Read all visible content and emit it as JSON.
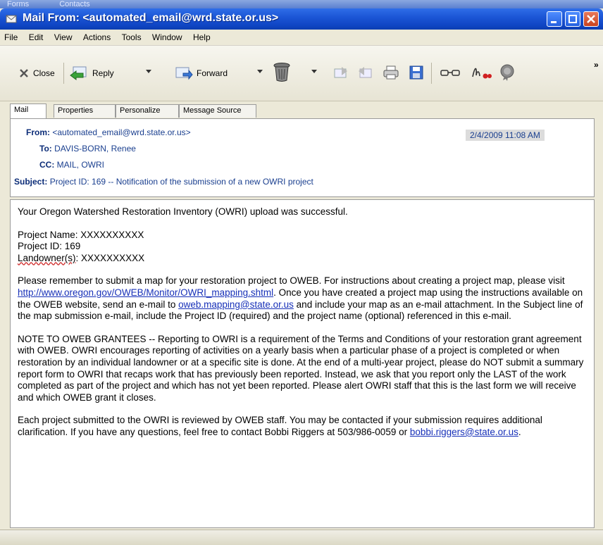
{
  "behind_window": {
    "items": [
      "Forms",
      "Contacts"
    ]
  },
  "window": {
    "title": "Mail From: <automated_email@wrd.state.or.us>"
  },
  "menu": [
    "File",
    "Edit",
    "View",
    "Actions",
    "Tools",
    "Window",
    "Help"
  ],
  "toolbar": {
    "close_label": "Close",
    "reply_label": "Reply",
    "forward_label": "Forward",
    "overflow": "»"
  },
  "tabs": [
    "Mail",
    "Properties",
    "Personalize",
    "Message Source"
  ],
  "header": {
    "from_label": "From:",
    "from_value": "<automated_email@wrd.state.or.us>",
    "date": "2/4/2009  11:08 AM",
    "to_label": "To:",
    "to_value": "DAVIS-BORN, Renee",
    "cc_label": "CC:",
    "cc_value": "MAIL, OWRI",
    "subject_label": "Subject:",
    "subject_value": "Project ID: 169 -- Notification of the submission of a new OWRI project"
  },
  "body": {
    "line1": "Your Oregon Watershed Restoration Inventory (OWRI) upload was successful.",
    "project_name": "Project Name: XXXXXXXXXX",
    "project_id": "Project ID: 169",
    "landowner_prefix": "Landowner(s)",
    "landowner_rest": ": XXXXXXXXXX",
    "p2_a": "Please remember to submit a map for your restoration project to OWEB.  For instructions about creating a project map, please visit ",
    "p2_link1": "http://www.oregon.gov/OWEB/Monitor/OWRI_mapping.shtml",
    "p2_b": ".  Once you have created a project map using the instructions available on the OWEB website, send an e-mail to ",
    "p2_link2": "oweb.mapping@state.or.us",
    "p2_c": " and include your map as an e-mail attachment.  In the Subject line of the map submission e-mail, include the Project ID (required) and the project name (optional) referenced in this e-mail.",
    "p3": "NOTE TO OWEB GRANTEES -- Reporting to OWRI is a requirement of the Terms and Conditions of your restoration grant agreement with OWEB.  OWRI encourages reporting of activities on a yearly basis when a particular phase of a project is completed or when restoration by an individual landowner or at a specific site is done.  At the end of a multi-year project, please do NOT submit a summary report form to OWRI that recaps work that has previously been reported.  Instead, we ask that you report only the LAST of the work completed as part of the project and which has not yet been reported.  Please alert OWRI staff that this is the last form we will receive and which OWEB grant it closes.",
    "p4_a": "Each project submitted to the OWRI is reviewed by OWEB staff.  You may be contacted if your submission requires additional clarification.  If you have any questions, feel free to contact Bobbi Riggers at 503/986-0059 or ",
    "p4_link": "bobbi.riggers@state.or.us",
    "p4_b": "."
  }
}
